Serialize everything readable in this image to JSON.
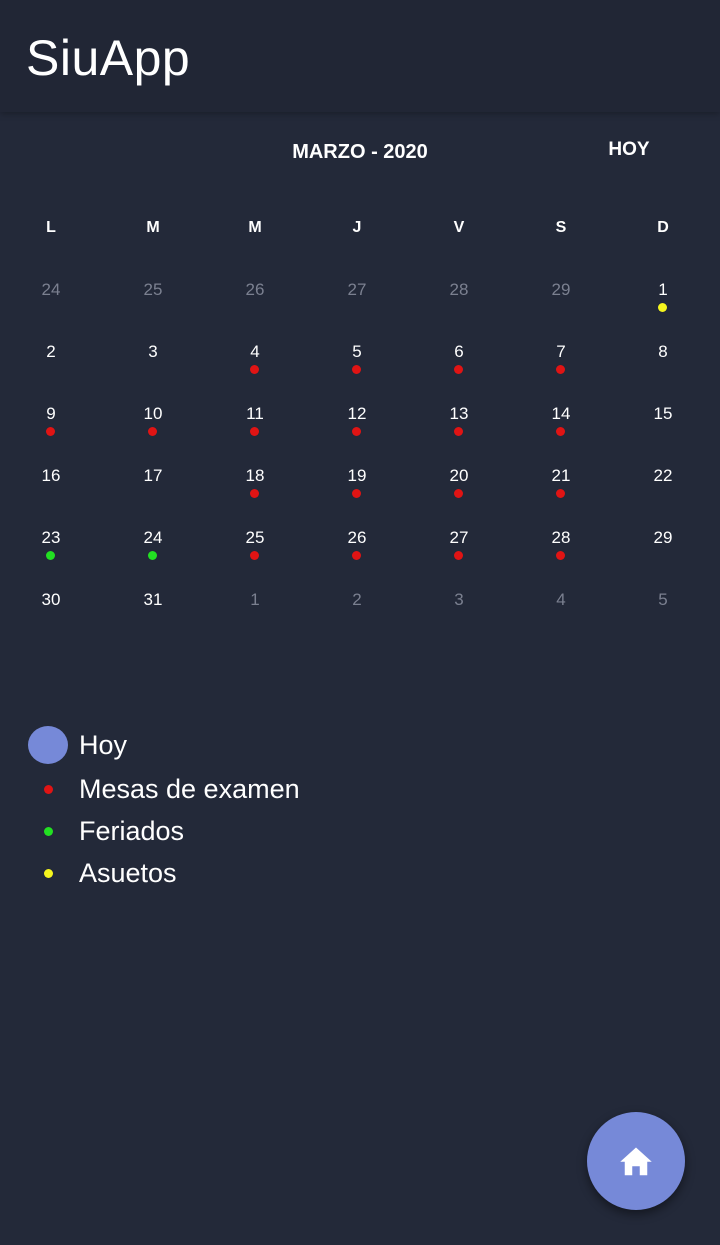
{
  "app": {
    "title": "SiuApp"
  },
  "calendar": {
    "month_label": "MARZO - 2020",
    "today_label": "HOY",
    "weekdays": [
      "L",
      "M",
      "M",
      "J",
      "V",
      "S",
      "D"
    ],
    "days": [
      {
        "n": "24",
        "outside": true,
        "dot": null
      },
      {
        "n": "25",
        "outside": true,
        "dot": null
      },
      {
        "n": "26",
        "outside": true,
        "dot": null
      },
      {
        "n": "27",
        "outside": true,
        "dot": null
      },
      {
        "n": "28",
        "outside": true,
        "dot": null
      },
      {
        "n": "29",
        "outside": true,
        "dot": null
      },
      {
        "n": "1",
        "outside": false,
        "dot": "asueto"
      },
      {
        "n": "2",
        "outside": false,
        "dot": null
      },
      {
        "n": "3",
        "outside": false,
        "dot": null
      },
      {
        "n": "4",
        "outside": false,
        "dot": "exam"
      },
      {
        "n": "5",
        "outside": false,
        "dot": "exam"
      },
      {
        "n": "6",
        "outside": false,
        "dot": "exam"
      },
      {
        "n": "7",
        "outside": false,
        "dot": "exam"
      },
      {
        "n": "8",
        "outside": false,
        "dot": null
      },
      {
        "n": "9",
        "outside": false,
        "dot": "exam"
      },
      {
        "n": "10",
        "outside": false,
        "dot": "exam"
      },
      {
        "n": "11",
        "outside": false,
        "dot": "exam"
      },
      {
        "n": "12",
        "outside": false,
        "dot": "exam"
      },
      {
        "n": "13",
        "outside": false,
        "dot": "exam"
      },
      {
        "n": "14",
        "outside": false,
        "dot": "exam"
      },
      {
        "n": "15",
        "outside": false,
        "dot": null
      },
      {
        "n": "16",
        "outside": false,
        "dot": null
      },
      {
        "n": "17",
        "outside": false,
        "dot": null
      },
      {
        "n": "18",
        "outside": false,
        "dot": "exam"
      },
      {
        "n": "19",
        "outside": false,
        "dot": "exam"
      },
      {
        "n": "20",
        "outside": false,
        "dot": "exam"
      },
      {
        "n": "21",
        "outside": false,
        "dot": "exam"
      },
      {
        "n": "22",
        "outside": false,
        "dot": null
      },
      {
        "n": "23",
        "outside": false,
        "dot": "holiday"
      },
      {
        "n": "24",
        "outside": false,
        "dot": "holiday"
      },
      {
        "n": "25",
        "outside": false,
        "dot": "exam"
      },
      {
        "n": "26",
        "outside": false,
        "dot": "exam"
      },
      {
        "n": "27",
        "outside": false,
        "dot": "exam"
      },
      {
        "n": "28",
        "outside": false,
        "dot": "exam"
      },
      {
        "n": "29",
        "outside": false,
        "dot": null
      },
      {
        "n": "30",
        "outside": false,
        "dot": null
      },
      {
        "n": "31",
        "outside": false,
        "dot": null
      },
      {
        "n": "1",
        "outside": true,
        "dot": null
      },
      {
        "n": "2",
        "outside": true,
        "dot": null
      },
      {
        "n": "3",
        "outside": true,
        "dot": null
      },
      {
        "n": "4",
        "outside": true,
        "dot": null
      },
      {
        "n": "5",
        "outside": true,
        "dot": null
      }
    ]
  },
  "legend": {
    "today": {
      "label": "Hoy",
      "color": "#7689d8"
    },
    "exam": {
      "label": "Mesas de examen",
      "color": "#e01414"
    },
    "holiday": {
      "label": "Feriados",
      "color": "#22e022"
    },
    "asueto": {
      "label": "Asuetos",
      "color": "#f5f51e"
    }
  },
  "fab": {
    "icon": "home-icon",
    "color": "#7689d8"
  }
}
